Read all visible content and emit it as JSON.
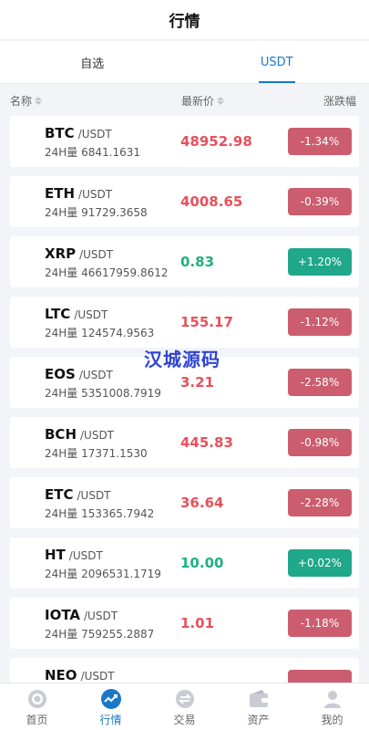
{
  "header": {
    "title": "行情"
  },
  "tabs": [
    {
      "label": "自选",
      "active": false
    },
    {
      "label": "USDT",
      "active": true
    }
  ],
  "columns": {
    "name": "名称",
    "price": "最新价",
    "change": "涨跌幅"
  },
  "rows": [
    {
      "symbol": "BTC",
      "quote": "/USDT",
      "volume": "24H量 6841.1631",
      "price": "48952.98",
      "change": "-1.34%",
      "dir": "down"
    },
    {
      "symbol": "ETH",
      "quote": "/USDT",
      "volume": "24H量 91729.3658",
      "price": "4008.65",
      "change": "-0.39%",
      "dir": "down"
    },
    {
      "symbol": "XRP",
      "quote": "/USDT",
      "volume": "24H量 46617959.8612",
      "price": "0.83",
      "change": "+1.20%",
      "dir": "up"
    },
    {
      "symbol": "LTC",
      "quote": "/USDT",
      "volume": "24H量 124574.9563",
      "price": "155.17",
      "change": "-1.12%",
      "dir": "down"
    },
    {
      "symbol": "EOS",
      "quote": "/USDT",
      "volume": "24H量 5351008.7919",
      "price": "3.21",
      "change": "-2.58%",
      "dir": "down"
    },
    {
      "symbol": "BCH",
      "quote": "/USDT",
      "volume": "24H量 17371.1530",
      "price": "445.83",
      "change": "-0.98%",
      "dir": "down"
    },
    {
      "symbol": "ETC",
      "quote": "/USDT",
      "volume": "24H量 153365.7942",
      "price": "36.64",
      "change": "-2.28%",
      "dir": "down"
    },
    {
      "symbol": "HT",
      "quote": "/USDT",
      "volume": "24H量 2096531.1719",
      "price": "10.00",
      "change": "+0.02%",
      "dir": "up"
    },
    {
      "symbol": "IOTA",
      "quote": "/USDT",
      "volume": "24H量 759255.2887",
      "price": "1.01",
      "change": "-1.18%",
      "dir": "down"
    },
    {
      "symbol": "NEO",
      "quote": "/USDT",
      "volume": "",
      "price": "",
      "change": "",
      "dir": "down"
    }
  ],
  "watermark": "汉城源码",
  "bottom_nav": [
    {
      "label": "首页",
      "icon": "home-icon",
      "active": false
    },
    {
      "label": "行情",
      "icon": "market-icon",
      "active": true
    },
    {
      "label": "交易",
      "icon": "trade-icon",
      "active": false
    },
    {
      "label": "资产",
      "icon": "wallet-icon",
      "active": false
    },
    {
      "label": "我的",
      "icon": "user-icon",
      "active": false
    }
  ],
  "colors": {
    "accent": "#1b78c8",
    "down": "#e8505b",
    "up": "#1fb07f",
    "down_badge": "#cc5d6f",
    "up_badge": "#1fa88a"
  }
}
